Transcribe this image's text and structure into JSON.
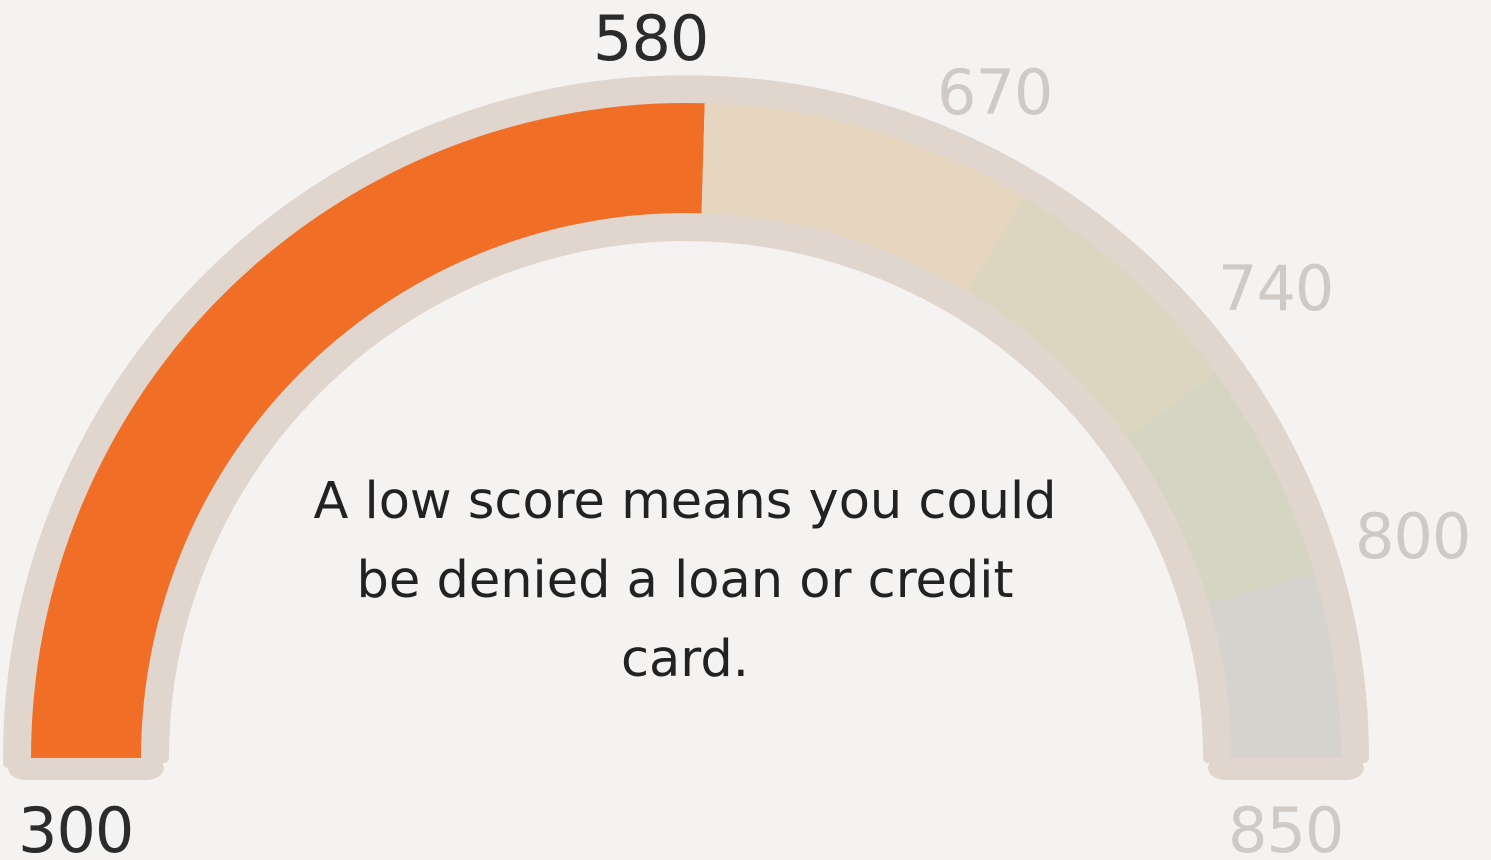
{
  "gauge": {
    "min": 300,
    "max": 850,
    "value": 580,
    "ticks": [
      {
        "label": "300",
        "active": true
      },
      {
        "label": "580",
        "active": true
      },
      {
        "label": "670",
        "active": false
      },
      {
        "label": "740",
        "active": false
      },
      {
        "label": "800",
        "active": false
      },
      {
        "label": "850",
        "active": false
      }
    ],
    "bands": [
      {
        "from": 300,
        "to": 580,
        "color": "#f06e26"
      },
      {
        "from": 580,
        "to": 670,
        "color": "#e6d6bf"
      },
      {
        "from": 670,
        "to": 740,
        "color": "#dcd5c0"
      },
      {
        "from": 740,
        "to": 800,
        "color": "#d5d5c4"
      },
      {
        "from": 800,
        "to": 850,
        "color": "#d4d3ce"
      }
    ],
    "track_color": "#e0d6ce"
  },
  "message": "A low score means you could be denied a loan or credit card."
}
